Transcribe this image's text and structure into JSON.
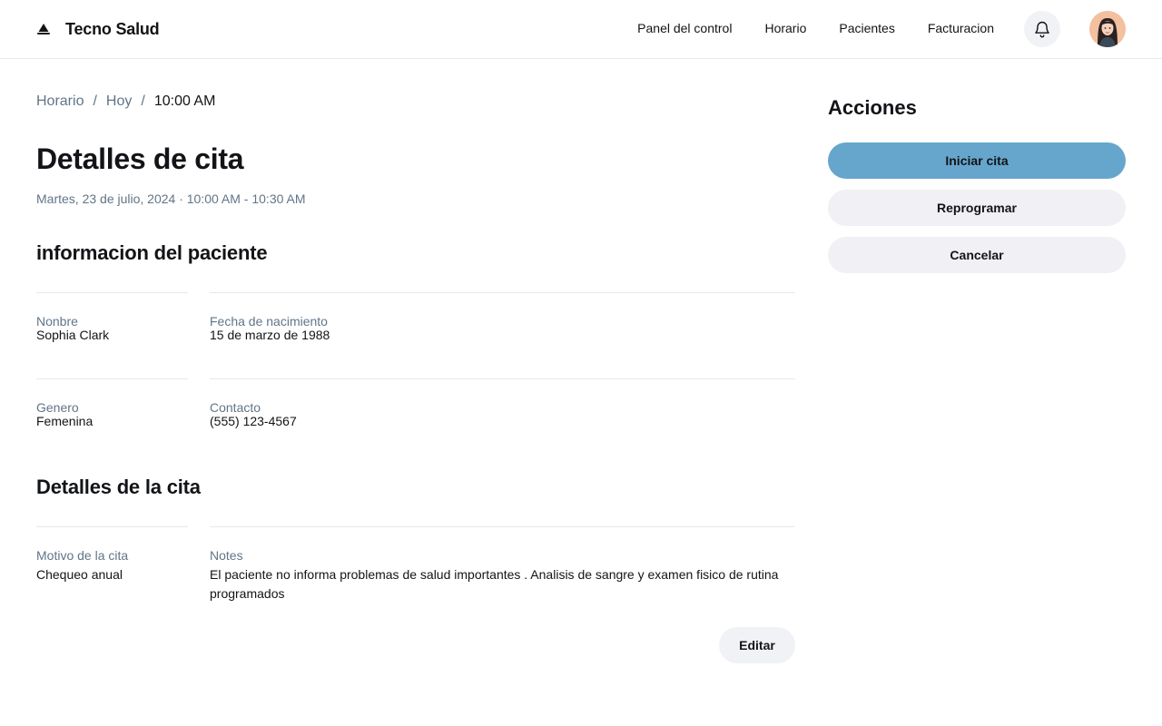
{
  "header": {
    "brand_name": "Tecno Salud",
    "nav": [
      "Panel del control",
      "Horario",
      "Pacientes",
      "Facturacion"
    ]
  },
  "breadcrumb": {
    "items": [
      "Horario",
      "Hoy"
    ],
    "separator": "/",
    "current": "10:00 AM"
  },
  "page": {
    "title": "Detalles de cita",
    "subtitle": "Martes, 23 de julio, 2024 · 10:00 AM - 10:30 AM"
  },
  "patient_info": {
    "title": "informacion del paciente",
    "fields": [
      {
        "label": "Nonbre",
        "value": "Sophia Clark"
      },
      {
        "label": "Fecha de nacimiento",
        "value": "15 de marzo de 1988"
      },
      {
        "label": "Genero",
        "value": "Femenina"
      },
      {
        "label": "Contacto",
        "value": "(555) 123-4567"
      }
    ]
  },
  "appointment_details": {
    "title": "Detalles de la cita",
    "reason_label": "Motivo de la cita",
    "reason_value": "Chequeo anual",
    "notes_label": "Notes",
    "notes_value": "El paciente no informa problemas de salud importantes . Analisis de sangre y examen  fisico de rutina programados",
    "edit_label": "Editar"
  },
  "actions": {
    "title": "Acciones",
    "start_label": "Iniciar cita",
    "reschedule_label": "Reprogramar",
    "cancel_label": "Cancelar"
  },
  "icons": {
    "logo": "brand-logo-icon",
    "notifications": "bell-icon",
    "avatar": "user-avatar"
  },
  "colors": {
    "primary_action": "#66a6cc",
    "button_secondary": "#f0f2f5",
    "muted_text": "#617587",
    "divider": "#e5e8eb"
  }
}
